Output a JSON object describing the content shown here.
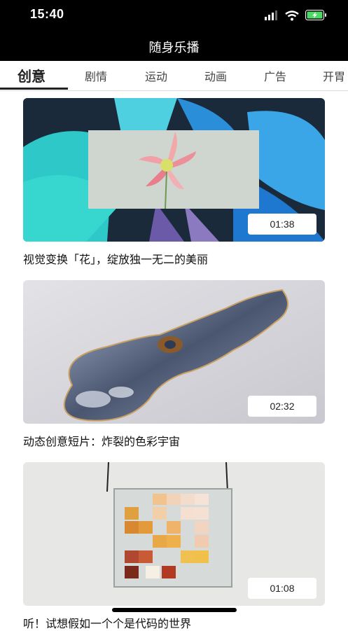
{
  "status": {
    "time": "15:40"
  },
  "nav": {
    "title": "随身乐播"
  },
  "tabs": [
    {
      "label": "创意",
      "active": true
    },
    {
      "label": "剧情"
    },
    {
      "label": "运动"
    },
    {
      "label": "动画"
    },
    {
      "label": "广告"
    },
    {
      "label": "开胃"
    }
  ],
  "videos": [
    {
      "title": "视觉变换「花」，绽放独一无二的美丽",
      "duration": "01:38"
    },
    {
      "title": "动态创意短片：炸裂的色彩宇宙",
      "duration": "02:32"
    },
    {
      "title": "听！试想假如一个个是代码的世界",
      "duration": "01:08"
    }
  ],
  "colors": {
    "accent": "#222222",
    "bar": "#000000"
  }
}
